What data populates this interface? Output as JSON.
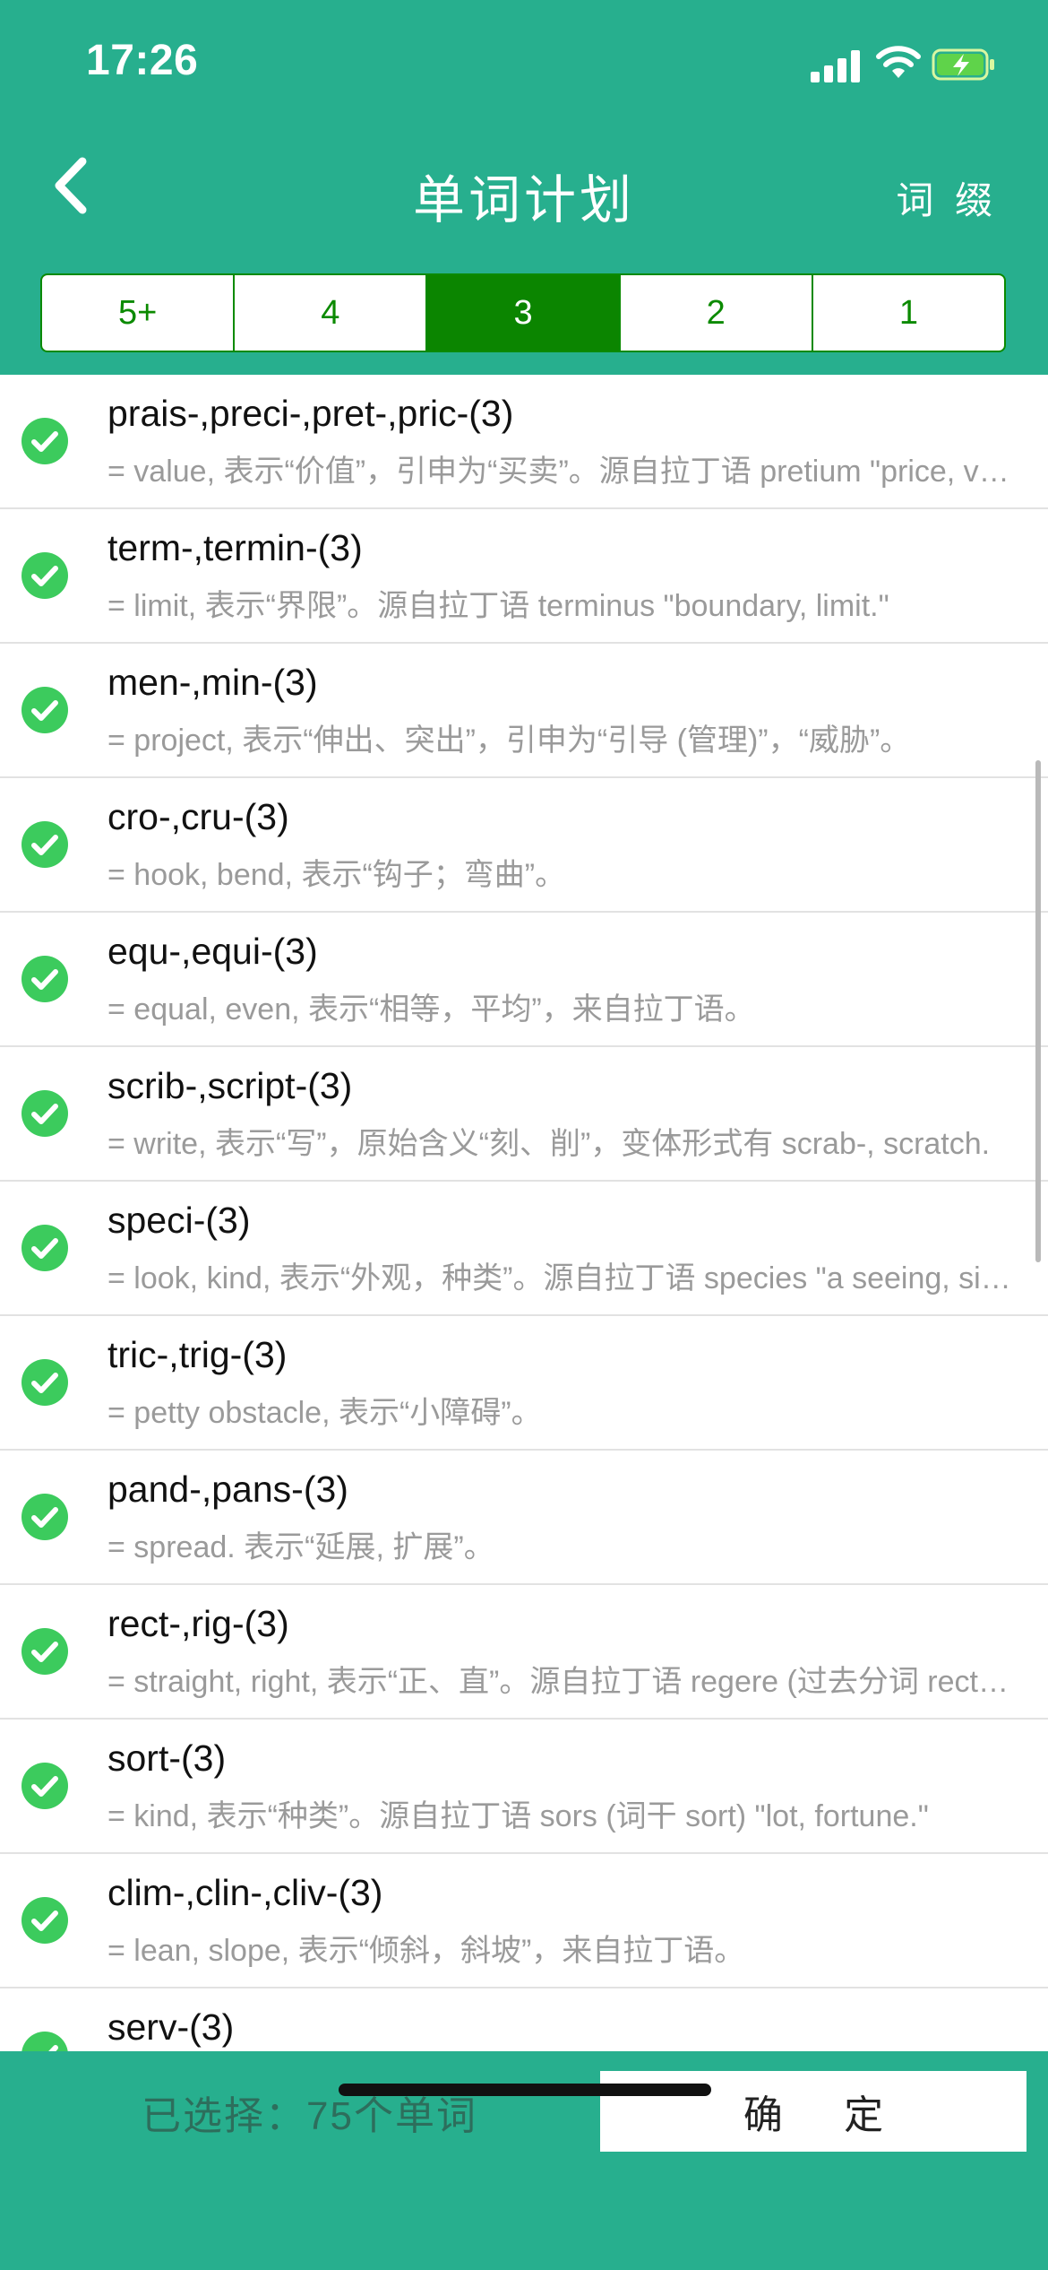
{
  "status_bar": {
    "time": "17:26"
  },
  "nav": {
    "title": "单词计划",
    "right_label": "词 缀"
  },
  "segments": [
    {
      "label": "5+",
      "active": false
    },
    {
      "label": "4",
      "active": false
    },
    {
      "label": "3",
      "active": true
    },
    {
      "label": "2",
      "active": false
    },
    {
      "label": "1",
      "active": false
    }
  ],
  "items": [
    {
      "title": "prais-,preci-,pret-,pric-(3)",
      "desc": "= value, 表示“价值”，引申为“买卖”。源自拉丁语 pretium \"price, value.\""
    },
    {
      "title": "term-,termin-(3)",
      "desc": "= limit, 表示“界限”。源自拉丁语 terminus \"boundary, limit.\""
    },
    {
      "title": "men-,min-(3)",
      "desc": "= project, 表示“伸出、突出”，引申为“引导 (管理)”，“威胁”。"
    },
    {
      "title": "cro-,cru-(3)",
      "desc": "= hook, bend, 表示“钩子；弯曲”。"
    },
    {
      "title": "equ-,equi-(3)",
      "desc": "= equal, even, 表示“相等，平均”，来自拉丁语。"
    },
    {
      "title": "scrib-,script-(3)",
      "desc": "= write, 表示“写”，原始含义“刻、削”，变体形式有 scrab-, scratch."
    },
    {
      "title": "speci-(3)",
      "desc": "= look, kind, 表示“外观，种类”。源自拉丁语 species \"a seeing, sight.\""
    },
    {
      "title": "tric-,trig-(3)",
      "desc": "= petty obstacle, 表示“小障碍”。"
    },
    {
      "title": "pand-,pans-(3)",
      "desc": "= spread. 表示“延展, 扩展”。"
    },
    {
      "title": "rect-,rig-(3)",
      "desc": "= straight, right, 表示“正、直”。源自拉丁语 regere (过去分词 rectus)."
    },
    {
      "title": "sort-(3)",
      "desc": "= kind, 表示“种类”。源自拉丁语 sors (词干 sort) \"lot, fortune.\""
    },
    {
      "title": "clim-,clin-,cliv-(3)",
      "desc": "= lean, slope, 表示“倾斜，斜坡”，来自拉丁语。"
    },
    {
      "title": "serv-(3)",
      "desc": ""
    }
  ],
  "footer": {
    "selected_text": "已选择：75个单词",
    "confirm_label": "确  定"
  }
}
